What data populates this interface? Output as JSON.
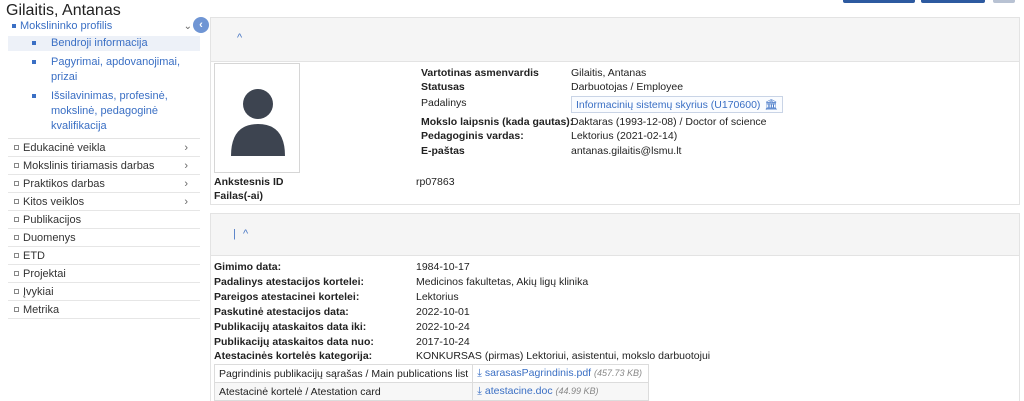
{
  "page": {
    "title": "Gilaitis, Antanas"
  },
  "sidebar": {
    "section": "Mokslininko profilis",
    "collapse_icon": "chevron-left-icon",
    "sub_items": [
      {
        "label": "Bendroji informacija"
      },
      {
        "label": "Pagyrimai, apdovanojimai, prizai"
      },
      {
        "label": "Išsilavinimas, profesinė, mokslinė, pedagoginė kvalifikacija"
      }
    ],
    "menu": [
      {
        "label": "Edukacinė veikla",
        "chevron": "›"
      },
      {
        "label": "Mokslinis tiriamasis darbas",
        "chevron": "›"
      },
      {
        "label": "Praktikos darbas",
        "chevron": "›"
      },
      {
        "label": "Kitos veiklos",
        "chevron": "›"
      },
      {
        "label": "Publikacijos",
        "chevron": ""
      },
      {
        "label": "Duomenys",
        "chevron": ""
      },
      {
        "label": "ETD",
        "chevron": ""
      },
      {
        "label": "Projektai",
        "chevron": ""
      },
      {
        "label": "Įvykiai",
        "chevron": ""
      },
      {
        "label": "Metrika",
        "chevron": ""
      }
    ]
  },
  "profile": {
    "fields": [
      {
        "label": "Vartotinas asmenvardis",
        "value": "Gilaitis, Antanas"
      },
      {
        "label": "Statusas",
        "value": "Darbuotojas / Employee"
      },
      {
        "label": "Padalinys",
        "value": "Informacinių sistemų skyrius (U170600)"
      },
      {
        "label": "Mokslo laipsnis (kada gautas):",
        "value": "Daktaras (1993-12-08) / Doctor of science"
      },
      {
        "label": "Pedagoginis vardas:",
        "value": "Lektorius (2021-02-14)"
      },
      {
        "label": "E-paštas",
        "value": "antanas.gilaitis@lsmu.lt"
      }
    ],
    "old_id_label": "Ankstesnis ID",
    "old_id_value": "rp07863",
    "files_label": "Failas(-ai)"
  },
  "attestation": {
    "fields": [
      {
        "label": "Gimimo data:",
        "value": "1984-10-17"
      },
      {
        "label": "Padalinys atestacijos kortelei:",
        "value": "Medicinos fakultetas, Akių ligų klinika"
      },
      {
        "label": "Pareigos atestacinei kortelei:",
        "value": "Lektorius"
      },
      {
        "label": "Paskutinė atestacijos data:",
        "value": "2022-10-01"
      },
      {
        "label": "Publikacijų ataskaitos data iki:",
        "value": "2022-10-24"
      },
      {
        "label": "Publikacijų ataskaitos data nuo:",
        "value": "2017-10-24"
      },
      {
        "label": "Atestacinės kortelės kategorija:",
        "value": "KONKURSAS (pirmas) Lektoriui, asistentui, mokslo darbuotojui"
      }
    ],
    "files": [
      {
        "name": "Pagrindinis publikacijų sąrašas / Main publications list",
        "file": "sarasasPagrindinis.pdf",
        "size": "(457.73 KB)"
      },
      {
        "name": "Atestacinė kortelė / Atestation card",
        "file": "atestacine.doc",
        "size": "(44.99 KB)"
      }
    ]
  }
}
